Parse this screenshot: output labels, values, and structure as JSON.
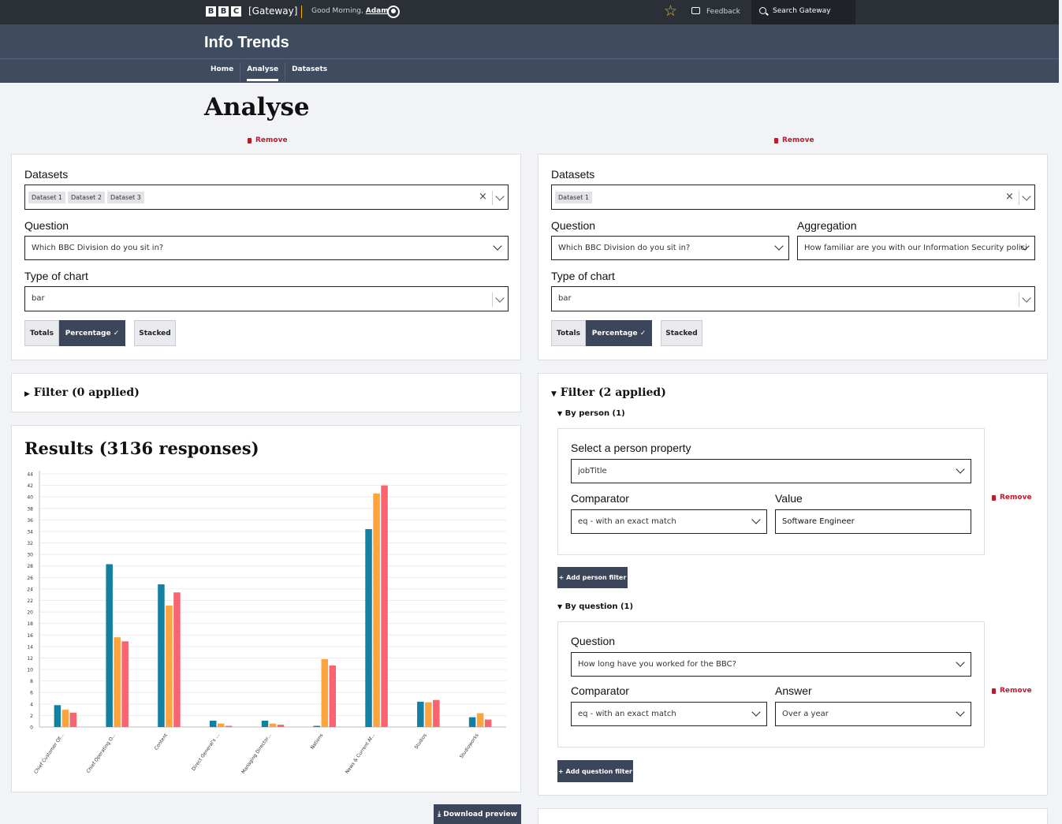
{
  "topbar": {
    "logo_letters": [
      "B",
      "B",
      "C"
    ],
    "gateway": "[Gateway]",
    "greeting": "Good Morning,",
    "user": "Adam",
    "feedback": "Feedback",
    "search": "Search Gateway"
  },
  "header": {
    "app_title": "Info Trends",
    "nav": [
      "Home",
      "Analyse",
      "Datasets"
    ],
    "active_nav": "Analyse"
  },
  "page_title": "Analyse",
  "left_panel": {
    "remove": "Remove",
    "datasets_label": "Datasets",
    "datasets": [
      "Dataset 1",
      "Dataset 2",
      "Dataset 3"
    ],
    "question_label": "Question",
    "question_value": "Which BBC Division do you sit in?",
    "chart_type_label": "Type of chart",
    "chart_type_value": "bar",
    "toggles": [
      "Totals",
      "Percentage",
      "Stacked"
    ],
    "active_toggle": "Percentage",
    "filter_head": "Filter (0 applied)",
    "results_title": "Results (3136 responses)",
    "download": "Download preview"
  },
  "right_panel": {
    "remove": "Remove",
    "datasets_label": "Datasets",
    "datasets": [
      "Dataset 1"
    ],
    "question_label": "Question",
    "question_value": "Which BBC Division do you sit in?",
    "aggregation_label": "Aggregation",
    "aggregation_value": "How familiar are you with our Information Security policies?",
    "chart_type_label": "Type of chart",
    "chart_type_value": "bar",
    "toggles": [
      "Totals",
      "Percentage",
      "Stacked"
    ],
    "active_toggle": "Percentage",
    "filter_head": "Filter (2 applied)",
    "by_person": {
      "head": "By person (1)",
      "property_label": "Select a person property",
      "property_value": "jobTitle",
      "comparator_label": "Comparator",
      "comparator_value": "eq - with an exact match",
      "value_label": "Value",
      "value_value": "Software Engineer",
      "remove": "Remove",
      "add_button": "Add person filter"
    },
    "by_question": {
      "head": "By question (1)",
      "question_label": "Question",
      "question_value": "How long have you worked for the BBC?",
      "comparator_label": "Comparator",
      "comparator_value": "eq - with an exact match",
      "answer_label": "Answer",
      "answer_value": "Over a year",
      "remove": "Remove",
      "add_button": "Add question filter"
    }
  },
  "chart_data": {
    "type": "bar",
    "categories": [
      "Chief Customer Of...",
      "Chief Operating O...",
      "Content",
      "Direct General's ...",
      "Managing Director...",
      "Nations",
      "News & Current Af...",
      "Studios",
      "Studioworks"
    ],
    "series": [
      {
        "color": "#1380a1",
        "values": [
          3.8,
          28.3,
          24.8,
          1.1,
          1.1,
          0.2,
          34.4,
          4.4,
          1.7
        ]
      },
      {
        "color": "#fca33d",
        "values": [
          3.0,
          15.6,
          21.1,
          0.6,
          0.6,
          11.8,
          40.6,
          4.3,
          2.4
        ]
      },
      {
        "color": "#fa6471",
        "values": [
          2.5,
          14.9,
          23.4,
          0.2,
          0.4,
          10.7,
          42.0,
          4.7,
          1.3
        ]
      }
    ],
    "yticks": [
      0,
      2,
      4,
      6,
      8,
      10,
      12,
      14,
      16,
      18,
      20,
      22,
      24,
      26,
      28,
      30,
      32,
      34,
      36,
      38,
      40,
      42,
      44
    ],
    "ylim": [
      0,
      44
    ],
    "grid": true
  }
}
